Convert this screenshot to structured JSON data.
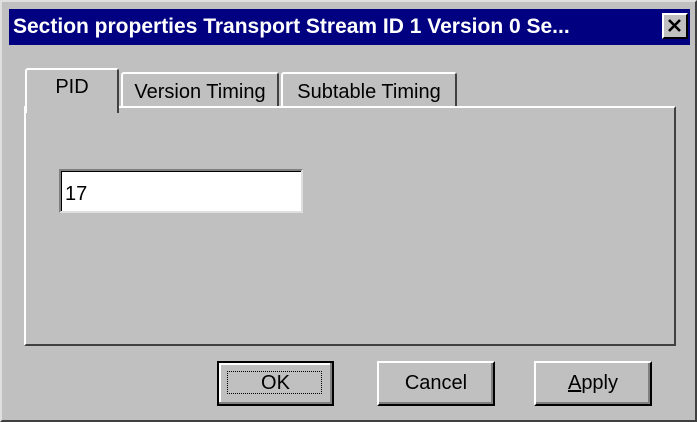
{
  "window": {
    "title": "Section properties Transport Stream ID 1 Version 0 Se..."
  },
  "tabs": [
    {
      "label": "PID",
      "active": true
    },
    {
      "label": "Version Timing",
      "active": false
    },
    {
      "label": "Subtable Timing",
      "active": false
    }
  ],
  "pid_field": {
    "value": "17"
  },
  "buttons": {
    "ok_label": "OK",
    "cancel_label": "Cancel",
    "apply_label_mnemonic": "A",
    "apply_label_rest": "pply"
  },
  "colors": {
    "titlebar": "#000080",
    "face": "#c0c0c0"
  }
}
